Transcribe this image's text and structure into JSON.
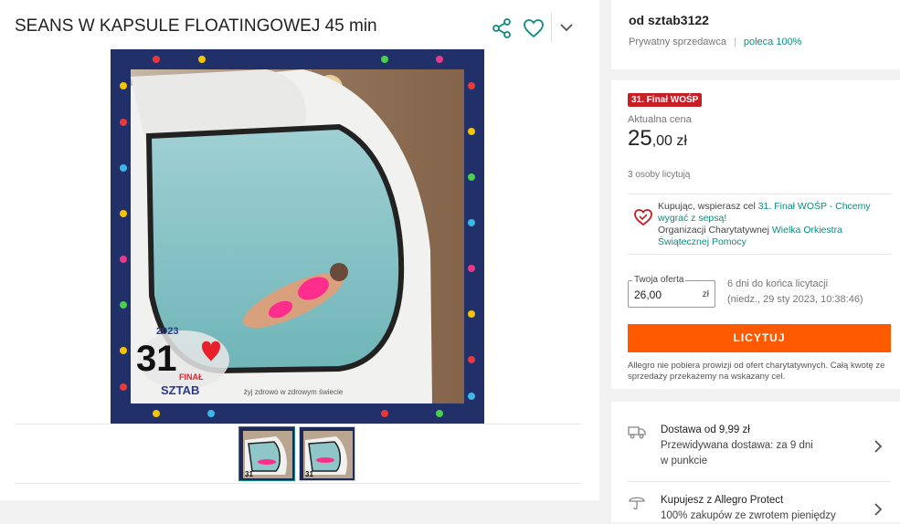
{
  "header": {
    "title": "SEANS W KAPSULE FLOATINGOWEJ 45 min"
  },
  "seller": {
    "name": "od sztab3122",
    "type": "Prywatny sprzedawca",
    "recommend": "poleca 100%"
  },
  "auction": {
    "badge": "31. Finał WOŚP",
    "price_label": "Aktualna cena",
    "price_main": "25",
    "price_dec": ",00 zł",
    "bidders": "3 osoby licytują",
    "charity_line1_prefix": "Kupując, wspierasz cel ",
    "charity_goal": "31. Finał WOŚP - Chcemy wygrać z sepsą!",
    "charity_org_prefix": "Organizacji Charytatywnej ",
    "charity_org": "Wielka Orkiestra Świątecznej Pomocy",
    "offer_label": "Twoja oferta",
    "offer_value": "26,00",
    "offer_currency": "zł",
    "time_left": "6 dni do końca licytacji",
    "end_date": "(niedz., 29 sty 2023, 10:38:46)",
    "bid_button": "LICYTUJ",
    "disclaimer": "Allegro nie pobiera prowizji od ofert charytatywnych. Całą kwotę ze sprzedaży przekażemy na wskazany cel."
  },
  "delivery": {
    "title": "Dostawa od 9,99 zł",
    "line2": "Przewidywana dostawa: za 9 dni",
    "line3": "w punkcie"
  },
  "protect": {
    "title": "Kupujesz z Allegro Protect",
    "line2": "100% zakupów ze zwrotem pieniędzy"
  },
  "image": {
    "frame_text": "żyj zdrowo w zdrowym świecie",
    "logo_year": "2023",
    "logo_number": "31",
    "logo_word": "FINAŁ",
    "logo_sub": "SZTAB"
  }
}
